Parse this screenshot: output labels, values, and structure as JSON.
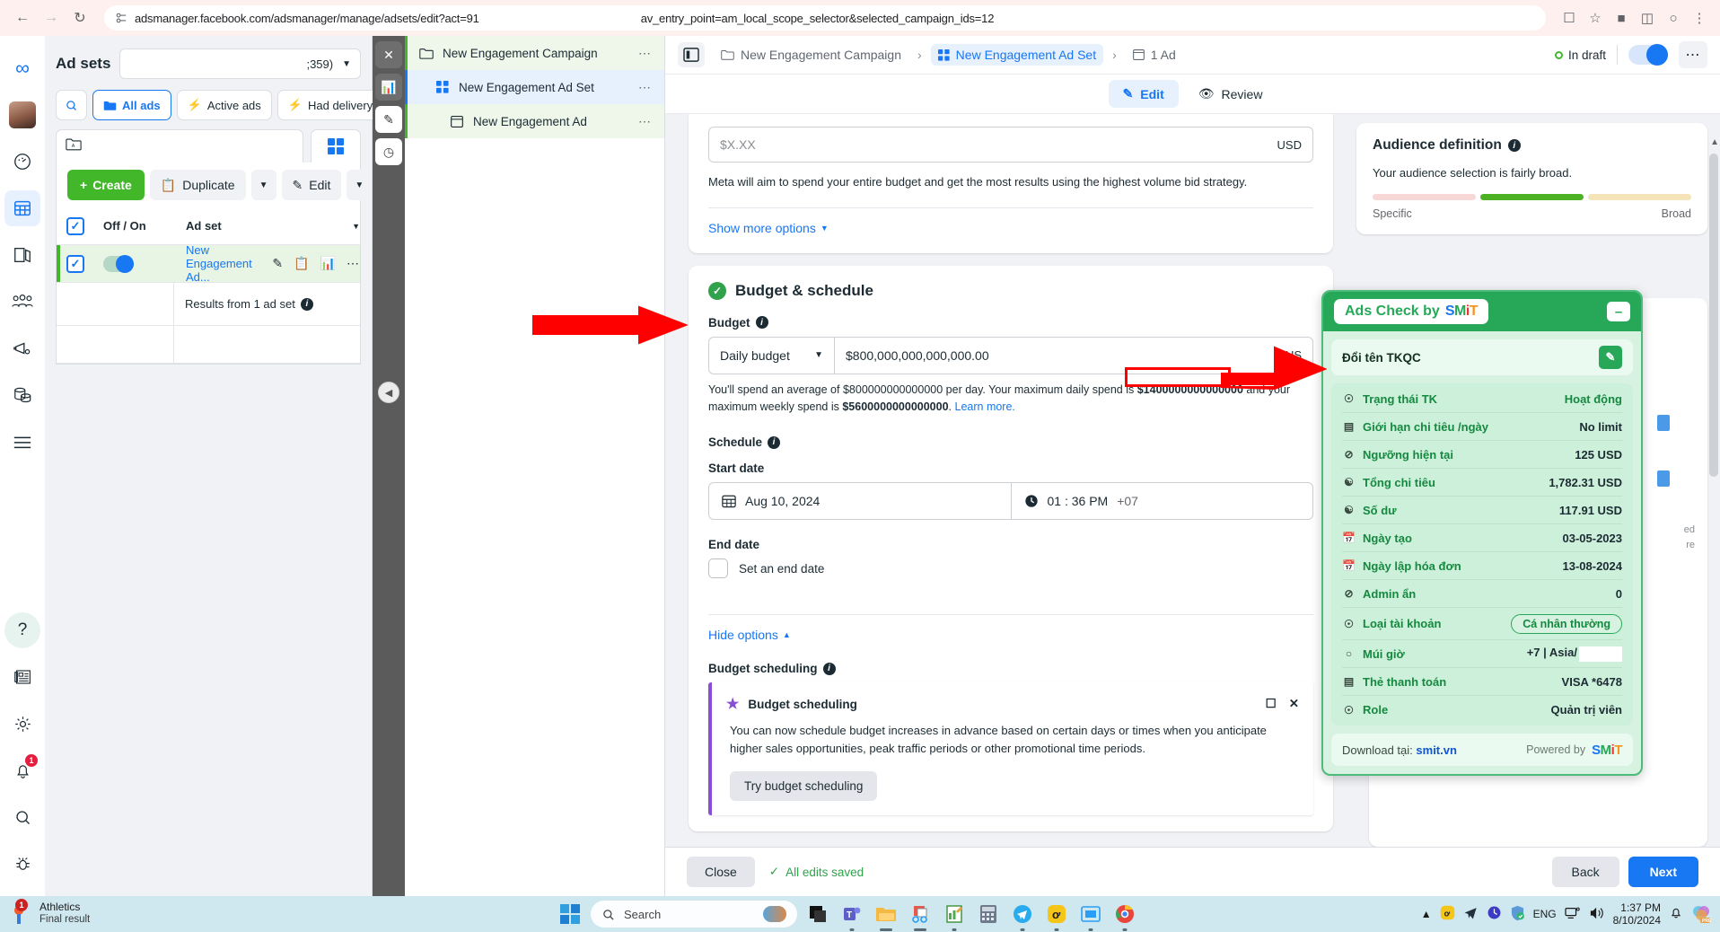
{
  "browser": {
    "url": "adsmanager.facebook.com/adsmanager/manage/adsets/edit?act=91",
    "url_tail": "av_entry_point=am_local_scope_selector&selected_campaign_ids=12",
    "back_icon": "back-arrow-icon",
    "forward_icon": "forward-arrow-icon",
    "reload_icon": "reload-icon",
    "site_icon": "site-settings-icon",
    "cast_icon": "cast-icon",
    "star_icon": "bookmark-star-icon",
    "extensions_icon": "extensions-puzzle-icon",
    "profile_icon": "profile-icon",
    "menu_icon": "chrome-menu-icon"
  },
  "fb_rail": {
    "logo": "meta-logo-icon",
    "items": [
      {
        "name": "avatar",
        "icon": "user-avatar"
      },
      {
        "name": "performance",
        "icon": "speedometer-icon"
      },
      {
        "name": "ads-manager",
        "icon": "table-grid-icon",
        "active": true
      },
      {
        "name": "library",
        "icon": "documents-icon"
      },
      {
        "name": "audiences",
        "icon": "people-icon"
      },
      {
        "name": "advertise",
        "icon": "megaphone-icon"
      },
      {
        "name": "billing",
        "icon": "coins-icon"
      },
      {
        "name": "all-tools",
        "icon": "hamburger-icon"
      }
    ],
    "bottom_items": [
      {
        "name": "help",
        "icon": "question-mark-icon"
      },
      {
        "name": "news",
        "icon": "newspaper-icon"
      },
      {
        "name": "settings",
        "icon": "gear-icon"
      },
      {
        "name": "notifications",
        "icon": "bell-icon",
        "badge": "1"
      },
      {
        "name": "search",
        "icon": "magnifier-icon"
      },
      {
        "name": "debug",
        "icon": "bug-icon"
      }
    ]
  },
  "adsets_panel": {
    "title": "Ad sets",
    "campaign_select_value": ";359)",
    "search_icon": "search-icon",
    "filters": [
      {
        "label": "All ads",
        "icon": "folder-icon",
        "active": true
      },
      {
        "label": "Active ads",
        "icon": "bolt-icon",
        "active": false
      },
      {
        "label": "Had delivery",
        "icon": "bolt-icon",
        "active": false
      }
    ],
    "breadcrumb_icon": "folder-a-icon",
    "grid_icon": "grid-view-icon",
    "actions": {
      "create": "Create",
      "duplicate": "Duplicate",
      "edit": "Edit",
      "delete_icon": "trash-icon",
      "caret_icon": "chevron-down-icon",
      "plus_icon": "plus-icon",
      "duplicate_icon": "copy-icon",
      "edit_icon": "pencil-icon"
    },
    "columns": {
      "onoff": "Off / On",
      "name": "Ad set"
    },
    "rows": [
      {
        "name": "New Engagement Ad...",
        "selected": true,
        "toggle_on": true,
        "row_icons": [
          "pencil-icon",
          "copy-icon",
          "chart-icon",
          "more-dots-icon"
        ]
      }
    ],
    "results_label": "Results from 1 ad set"
  },
  "dark_rail": {
    "buttons": [
      {
        "name": "close",
        "icon": "close-x-icon"
      },
      {
        "name": "chart",
        "icon": "bar-chart-icon"
      },
      {
        "name": "edit",
        "icon": "pencil-icon",
        "active": true
      },
      {
        "name": "history",
        "icon": "clock-icon"
      }
    ],
    "collapse_icon": "chevron-left-icon"
  },
  "tree_panel": {
    "items": [
      {
        "label": "New Engagement Campaign",
        "icon": "folder-icon",
        "state": "green",
        "indent": 0
      },
      {
        "label": "New Engagement Ad Set",
        "icon": "adset-grid-icon",
        "state": "blue",
        "indent": 1
      },
      {
        "label": "New Engagement Ad",
        "icon": "ad-window-icon",
        "state": "green",
        "indent": 2
      }
    ],
    "more_icon": "more-dots-icon"
  },
  "editor": {
    "panel_toggle_icon": "side-panel-icon",
    "breadcrumb": [
      {
        "label": "New Engagement Campaign",
        "icon": "folder-icon",
        "active": false
      },
      {
        "label": "New Engagement Ad Set",
        "icon": "adset-grid-icon",
        "active": true
      },
      {
        "label": "1 Ad",
        "icon": "ad-window-icon",
        "active": false
      }
    ],
    "breadcrumb_sep": "›",
    "status": "In draft",
    "more_icon": "more-dots-icon",
    "tabs": [
      {
        "label": "Edit",
        "icon": "pencil-icon",
        "active": true
      },
      {
        "label": "Review",
        "icon": "eye-icon",
        "active": false
      }
    ],
    "bid_amount_placeholder": "$X.XX",
    "bid_currency": "USD",
    "bid_help": "Meta will aim to spend your entire budget and get the most results using the highest volume bid strategy.",
    "show_more_options": "Show more options",
    "budget_section": {
      "heading": "Budget & schedule",
      "budget_label": "Budget",
      "budget_type": "Daily budget",
      "budget_value": "$800,000,000,000,000.00",
      "currency": "US",
      "spend_note_1": "You'll spend an average of $800000000000000 per day. Your maximum daily spend is ",
      "spend_note_bold_1": "$1400000000000000",
      "spend_note_2": " and your maximum weekly spend is ",
      "spend_note_bold_2": "$5600000000000000",
      "spend_note_3": ". ",
      "learn_more": "Learn more."
    },
    "schedule": {
      "heading": "Schedule",
      "start_date_label": "Start date",
      "start_date": "Aug 10, 2024",
      "start_time": "01 : 36 PM",
      "start_tz": "+07",
      "calendar_icon": "calendar-icon",
      "clock_icon": "clock-icon",
      "end_date_label": "End date",
      "end_date_checkbox": "Set an end date",
      "hide_options": "Hide options"
    },
    "budget_scheduling": {
      "field_label": "Budget scheduling",
      "promo_title": "Budget scheduling",
      "star_icon": "star-icon",
      "feedback_icon": "feedback-icon",
      "close_icon": "close-x-icon",
      "promo_body": "You can now schedule budget increases in advance based on certain days or times when you anticipate higher sales opportunities, peak traffic periods or other promotional time periods.",
      "promo_button": "Try budget scheduling"
    },
    "footer": {
      "close": "Close",
      "saved": "All edits saved",
      "back": "Back",
      "next": "Next",
      "check_icon": "check-icon"
    }
  },
  "audience": {
    "title": "Audience definition",
    "subtitle": "Your audience selection is fairly broad.",
    "scale_left": "Specific",
    "scale_right": "Broad",
    "bar_colors": [
      "#f8d7d7",
      "#4db223",
      "#f5e4b8"
    ]
  },
  "smit": {
    "title": "Ads Check by",
    "logo_letters": [
      {
        "ch": "S",
        "color": "#1877f2"
      },
      {
        "ch": "M",
        "color": "#27a858"
      },
      {
        "ch": "i",
        "color": "#e23b2e"
      },
      {
        "ch": "T",
        "color": "#f7941d"
      }
    ],
    "minimize_icon": "minimize-icon",
    "rename_label": "Đổi tên TKQC",
    "rename_icon": "edit-square-icon",
    "rows": [
      {
        "icon": "user-circle-icon",
        "label": "Trạng thái TK",
        "value": "Hoạt động",
        "value_style": "green"
      },
      {
        "icon": "list-icon",
        "label": "Giới hạn chi tiêu /ngày",
        "value": "No limit",
        "value_style": "dark"
      },
      {
        "icon": "circle-slash-icon",
        "label": "Ngưỡng hiện tại",
        "value": "125 USD",
        "value_style": "dark"
      },
      {
        "icon": "hand-coin-icon",
        "label": "Tổng chi tiêu",
        "value": "1,782.31 USD",
        "value_style": "dark"
      },
      {
        "icon": "hand-coin-icon",
        "label": "Số dư",
        "value": "117.91 USD",
        "value_style": "dark"
      },
      {
        "icon": "calendar-icon",
        "label": "Ngày tạo",
        "value": "03-05-2023",
        "value_style": "dark"
      },
      {
        "icon": "calendar-icon",
        "label": "Ngày lập hóa đơn",
        "value": "13-08-2024",
        "value_style": "dark"
      },
      {
        "icon": "circle-slash-icon",
        "label": "Admin ẩn",
        "value": "0",
        "value_style": "dark"
      },
      {
        "icon": "user-circle-icon",
        "label": "Loại tài khoản",
        "value": "Cá nhân thường",
        "value_style": "pill"
      },
      {
        "icon": "pin-icon",
        "label": "Múi giờ",
        "value": "+7 | Asia/",
        "value_style": "redacted"
      },
      {
        "icon": "card-icon",
        "label": "Thẻ thanh toán",
        "value": "VISA *6478",
        "value_style": "dark"
      },
      {
        "icon": "user-circle-icon",
        "label": "Role",
        "value": "Quản trị viên",
        "value_style": "dark"
      }
    ],
    "footer_download": "Download tại:",
    "footer_link": "smit.vn",
    "footer_powered": "Powered by",
    "accent": "#27a858"
  },
  "annotations": {
    "arrow_color": "#ff0000",
    "highlight_box_target": "Giới hạn chi tiêu /ngày"
  },
  "taskbar": {
    "news_title": "Athletics",
    "news_sub": "Final result",
    "news_badge": "1",
    "start_icon": "windows-start-icon",
    "search_placeholder": "Search",
    "search_icon": "search-icon",
    "apps": [
      {
        "name": "dark-app",
        "icon": "app-dark-icon"
      },
      {
        "name": "teams",
        "icon": "teams-icon"
      },
      {
        "name": "file-explorer",
        "icon": "folder-icon"
      },
      {
        "name": "snipping-tool",
        "icon": "scissors-icon"
      },
      {
        "name": "notes",
        "icon": "note-edit-icon"
      },
      {
        "name": "calculator",
        "icon": "calculator-icon"
      },
      {
        "name": "telegram",
        "icon": "telegram-icon"
      },
      {
        "name": "zalo",
        "icon": "zalo-icon"
      },
      {
        "name": "window-app",
        "icon": "window-icon"
      },
      {
        "name": "chrome",
        "icon": "chrome-icon"
      }
    ],
    "tray": [
      {
        "name": "show-hidden",
        "icon": "chevron-up-icon"
      },
      {
        "name": "zalo-tray",
        "icon": "zalo-icon"
      },
      {
        "name": "telegram-tray",
        "icon": "telegram-icon"
      },
      {
        "name": "clock-tray",
        "icon": "clock-icon"
      },
      {
        "name": "defender",
        "icon": "shield-check-icon"
      }
    ],
    "language": "ENG",
    "network_icon": "network-icon",
    "volume_icon": "speaker-icon",
    "time": "1:37 PM",
    "date": "8/10/2024",
    "bell_icon": "bell-icon",
    "copilot_icon": "copilot-icon"
  }
}
